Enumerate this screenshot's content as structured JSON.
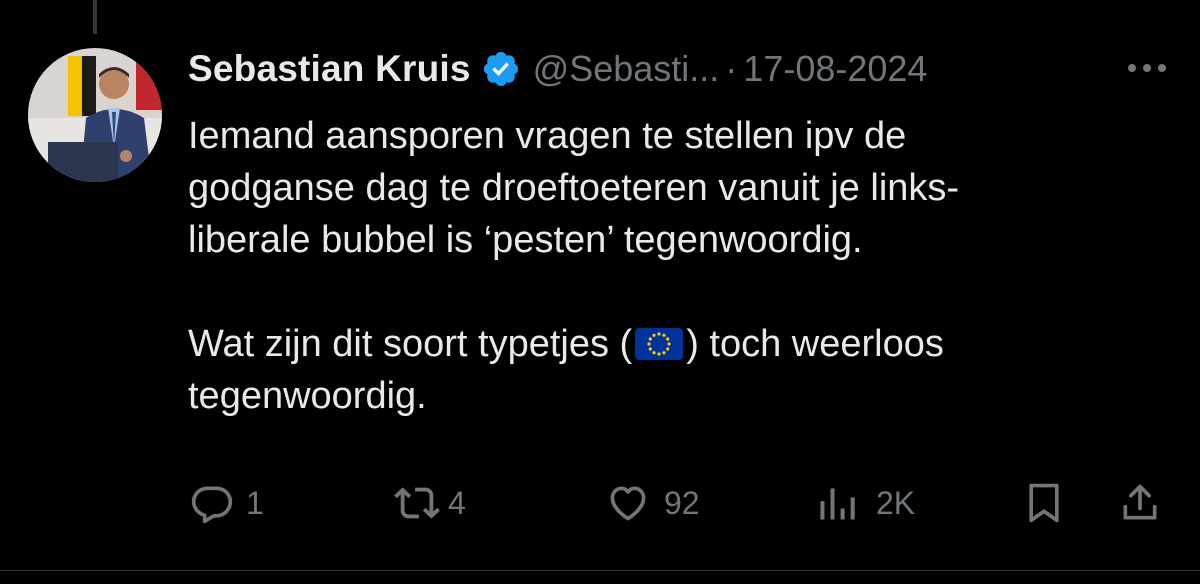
{
  "tweet": {
    "author": {
      "display_name": "Sebastian Kruis",
      "handle": "@Sebasti...",
      "verified": true
    },
    "separator": "·",
    "date": "17-08-2024",
    "text": {
      "paragraph1": [
        "Iemand aansporen vragen te stellen ipv de",
        "godganse dag te droeftoeteren vanuit je links-",
        "liberale bubbel is ‘pesten’ tegenwoordig."
      ],
      "paragraph2_line1_before_flag": "Wat zijn dit soort typetjes (",
      "paragraph2_line1_after_flag": ") toch weerloos",
      "paragraph2_line2": "tegenwoordig."
    },
    "flag_icon": "eu-flag-emoji"
  },
  "actions": {
    "replies": "1",
    "reposts": "4",
    "likes": "92",
    "views": "2K"
  },
  "colors": {
    "background": "#000000",
    "text": "#e7e9ea",
    "muted": "#71767b",
    "verified_blue": "#1d9bf0",
    "eu_blue": "#003399",
    "eu_gold": "#ffcc00"
  }
}
